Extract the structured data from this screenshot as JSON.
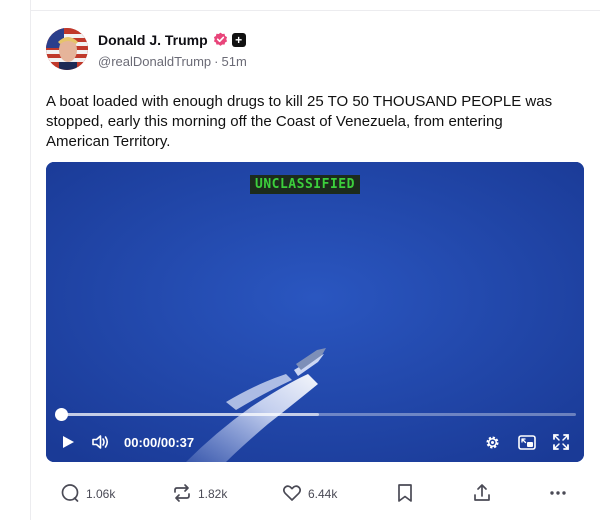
{
  "post": {
    "display_name": "Donald J. Trump",
    "handle": "@realDonaldTrump",
    "separator": "·",
    "time_ago": "51m",
    "plus_badge": "+",
    "text": "A boat loaded with enough drugs to kill 25 TO 50 THOUSAND PEOPLE was stopped, early this morning off the Coast of Venezuela, from entering American Territory."
  },
  "video": {
    "overlay_label": "UNCLASSIFIED",
    "time": "00:00/00:37",
    "progress": 0,
    "buffered": 0.5
  },
  "actions": {
    "replies": "1.06k",
    "reposts": "1.82k",
    "likes": "6.44k"
  },
  "icons": {
    "verified": "verified-badge-icon",
    "play": "play-icon",
    "volume": "volume-icon",
    "settings": "gear-icon",
    "pip": "picture-in-picture-icon",
    "fullscreen": "fullscreen-icon",
    "reply": "speech-bubble-icon",
    "repost": "repost-icon",
    "like": "heart-icon",
    "bookmark": "bookmark-icon",
    "share": "share-icon",
    "more": "more-icon"
  },
  "colors": {
    "verified": "#e8457a",
    "video_sea": "#1f44a8",
    "overlay_text": "#3ccf3c"
  }
}
